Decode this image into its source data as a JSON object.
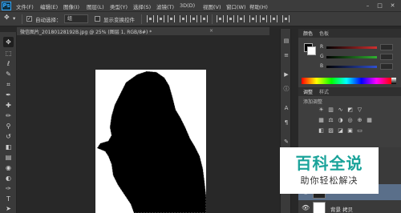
{
  "app": {
    "logo": "Ps"
  },
  "menu": [
    "文件(F)",
    "编辑(E)",
    "图像(I)",
    "图层(L)",
    "类型(Y)",
    "选择(S)",
    "滤镜(T)",
    "3D(D)",
    "视图(V)",
    "窗口(W)",
    "帮助(H)"
  ],
  "window_controls": {
    "minimize": "–",
    "maximize": "□",
    "close": "✕"
  },
  "options_bar": {
    "auto_select_label": "自动选择：",
    "auto_select_value": "组",
    "show_transform_label": "显示变换控件",
    "auto_select_checked": "✓"
  },
  "document": {
    "tab_label": "微信图片_20180128192B.jpg @ 25% (图层 1, RGB/8#) *",
    "close": "×"
  },
  "tools": [
    {
      "icon": "move-icon",
      "glyph": "✥"
    },
    {
      "icon": "marquee-icon",
      "glyph": "⬚"
    },
    {
      "icon": "lasso-icon",
      "glyph": "ℓ"
    },
    {
      "icon": "quick-select-icon",
      "glyph": "✎"
    },
    {
      "icon": "crop-icon",
      "glyph": "⌗"
    },
    {
      "icon": "eyedropper-icon",
      "glyph": "✒"
    },
    {
      "icon": "healing-icon",
      "glyph": "✚"
    },
    {
      "icon": "brush-icon",
      "glyph": "✏"
    },
    {
      "icon": "stamp-icon",
      "glyph": "⚲"
    },
    {
      "icon": "history-brush-icon",
      "glyph": "↺"
    },
    {
      "icon": "eraser-icon",
      "glyph": "◧"
    },
    {
      "icon": "gradient-icon",
      "glyph": "▤"
    },
    {
      "icon": "blur-icon",
      "glyph": "◉"
    },
    {
      "icon": "dodge-icon",
      "glyph": "◐"
    },
    {
      "icon": "pen-icon",
      "glyph": "✑"
    },
    {
      "icon": "type-icon",
      "glyph": "T"
    },
    {
      "icon": "path-select-icon",
      "glyph": "➤"
    }
  ],
  "panels": {
    "color_tabs": [
      "颜色",
      "色板"
    ],
    "color_sliders": [
      {
        "label": "R",
        "color": "#d03030"
      },
      {
        "label": "G",
        "color": "#30b030"
      },
      {
        "label": "B",
        "color": "#3050d0"
      }
    ],
    "adjust_tabs": [
      "调整",
      "样式"
    ],
    "adjust_heading": "添加调整",
    "layers": [
      {
        "name": "",
        "selected": true
      },
      {
        "name": "背景 拷贝",
        "selected": false
      }
    ],
    "percent_boxes": [
      "%",
      "%"
    ]
  },
  "watermark": {
    "title": "百科全说",
    "subtitle": "助你轻松解决",
    "color": "#1aa39a"
  }
}
